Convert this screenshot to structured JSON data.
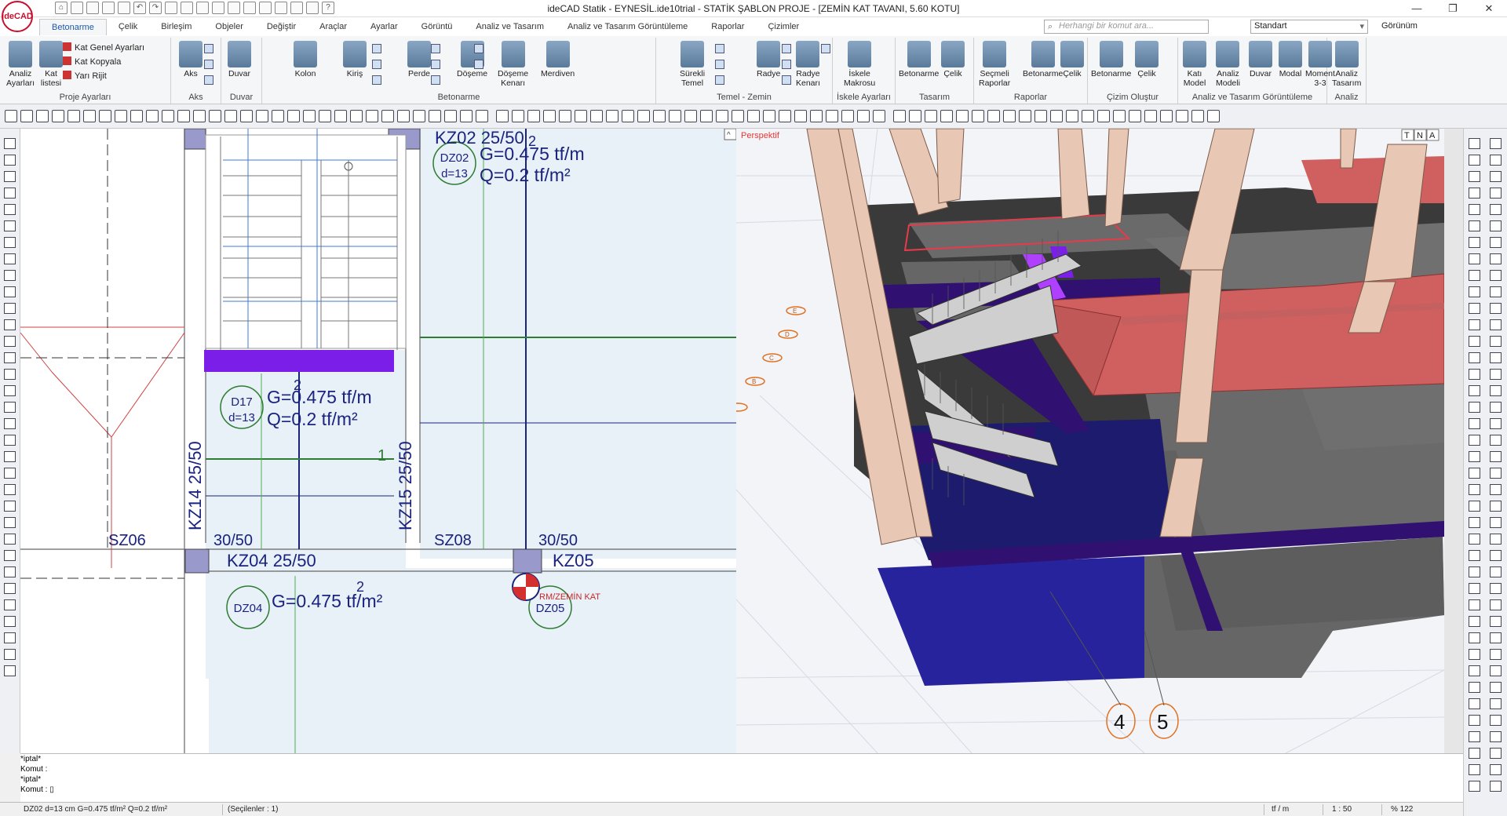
{
  "app": {
    "logo_text": "ideCAD",
    "title": "ideCAD Statik - EYNESİL.ide10trial - STATİK ŞABLON PROJE - [ZEMİN KAT TAVANI,  5.60 KOTU]"
  },
  "window_controls": {
    "minimize": "—",
    "restore": "❐",
    "close": "✕"
  },
  "tabs": [
    "Betonarme",
    "Çelik",
    "Birleşim",
    "Objeler",
    "Değiştir",
    "Araçlar",
    "Ayarlar",
    "Görüntü",
    "Analiz ve Tasarım",
    "Analiz ve Tasarım Görüntüleme",
    "Raporlar",
    "Çizimler"
  ],
  "command_search": {
    "placeholder": "Herhangi bir komut ara..."
  },
  "style_select": {
    "value": "Standart"
  },
  "view_menu": {
    "label": "Görünüm"
  },
  "ribbon": {
    "groups": [
      {
        "label": "Proje Ayarları",
        "buttons": [
          [
            "Analiz",
            "Ayarları"
          ],
          [
            "Kat",
            "listesi"
          ]
        ],
        "small": [
          "Kat Genel Ayarları",
          "Kat Kopyala",
          "Yarı Rijit"
        ]
      },
      {
        "label": "Aks",
        "buttons": [
          [
            "Aks"
          ]
        ]
      },
      {
        "label": "Duvar",
        "buttons": [
          [
            "Duvar"
          ]
        ]
      },
      {
        "label": "Betonarme",
        "buttons": [
          [
            "Kolon"
          ],
          [
            "Kiriş"
          ],
          [
            "Perde"
          ],
          [
            "Döşeme"
          ],
          [
            "Döşeme",
            "Kenarı"
          ],
          [
            "Merdiven"
          ]
        ]
      },
      {
        "label": "Temel - Zemin",
        "buttons": [
          [
            "Sürekli",
            "Temel"
          ],
          [
            "Radye"
          ],
          [
            "Radye",
            "Kenarı"
          ]
        ]
      },
      {
        "label": "İskele Ayarları",
        "buttons": [
          [
            "İskele",
            "Makrosu"
          ]
        ]
      },
      {
        "label": "Tasarım",
        "buttons": [
          [
            "Betonarme"
          ],
          [
            "Çelik"
          ]
        ]
      },
      {
        "label": "Raporlar",
        "buttons": [
          [
            "Seçmeli",
            "Raporlar"
          ],
          [
            "Betonarme"
          ],
          [
            "Çelik"
          ]
        ]
      },
      {
        "label": "Çizim Oluştur",
        "buttons": [
          [
            "Betonarme"
          ],
          [
            "Çelik"
          ]
        ]
      },
      {
        "label": "Analiz ve Tasarım Görüntüleme",
        "buttons": [
          [
            "Katı",
            "Model"
          ],
          [
            "Analiz",
            "Modeli"
          ],
          [
            "Duvar"
          ],
          [
            "Modal"
          ],
          [
            "Moment",
            "3-3"
          ]
        ]
      },
      {
        "label": "Analiz",
        "buttons": [
          [
            "Analiz",
            "Tasarım"
          ]
        ]
      }
    ]
  },
  "plan": {
    "beams": {
      "kz02": "KZ02 25/50",
      "kz04": "KZ04 25/50",
      "kz05": "KZ05",
      "kz14": "KZ14 25/50",
      "kz15": "KZ15 25/50"
    },
    "columns": {
      "sz06": "SZ06",
      "sz08": "SZ08",
      "c1": "30/50",
      "c2": "30/50"
    },
    "slabs": {
      "dz02": {
        "name": "DZ02",
        "d": "d=13",
        "g": "G=0.475 tf/m",
        "q": "Q=0.2 tf/m²"
      },
      "d17": {
        "name": "D17",
        "d": "d=13",
        "g": "G=0.475 tf/m",
        "q": "Q=0.2 tf/m²"
      },
      "dz04": {
        "name": "DZ04",
        "g": "G=0.475 tf/m²"
      },
      "dz05": {
        "name": "DZ05"
      }
    },
    "dir_labels": {
      "a": "2",
      "b": "2",
      "c": "2",
      "d": "1"
    },
    "rm_label": "RM/ZEMİN KAT"
  },
  "perspective": {
    "label": "Perspektif",
    "view_buttons": [
      "T",
      "N",
      "A"
    ],
    "axis_labels": [
      "A",
      "B",
      "C",
      "D",
      "E"
    ],
    "grid_labels": [
      "4",
      "5"
    ]
  },
  "command_log": [
    "*iptal*",
    "Komut :",
    "*iptal*",
    "Komut : ▯"
  ],
  "status": {
    "selection": "DZ02 d=13 cm G=0.475 tf/m² Q=0.2 tf/m²",
    "selected": "(Seçilenler : 1)",
    "unit": "tf / m",
    "scale": "1 : 50",
    "zoom": "% 122"
  },
  "colors": {
    "accent": "#1e5aa8",
    "slab_purple": "#7b1fe8",
    "roof_red": "#d06060",
    "beam_dark": "#301070",
    "slab_gray": "#686868"
  }
}
